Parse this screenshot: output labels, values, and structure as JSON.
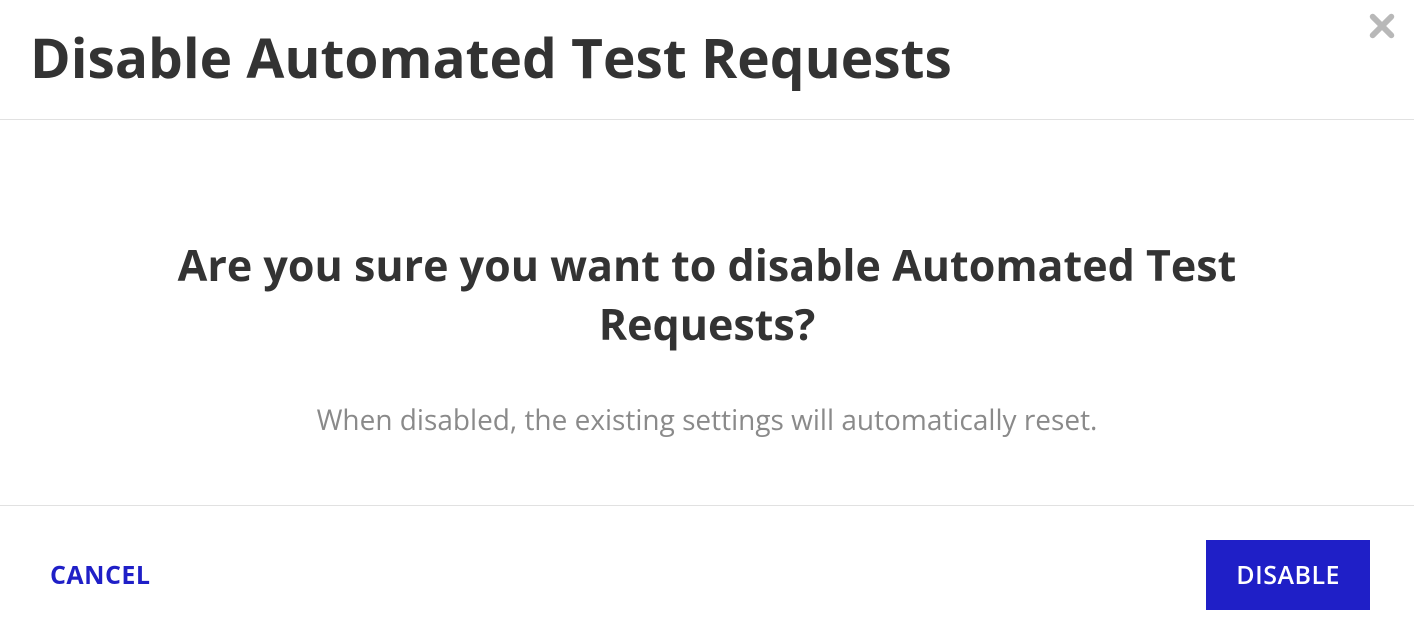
{
  "modal": {
    "title": "Disable Automated Test Requests",
    "heading": "Are you sure you want to disable Automated Test Requests?",
    "subtext": "When disabled, the existing settings will automatically reset.",
    "cancel_label": "CANCEL",
    "confirm_label": "DISABLE"
  }
}
